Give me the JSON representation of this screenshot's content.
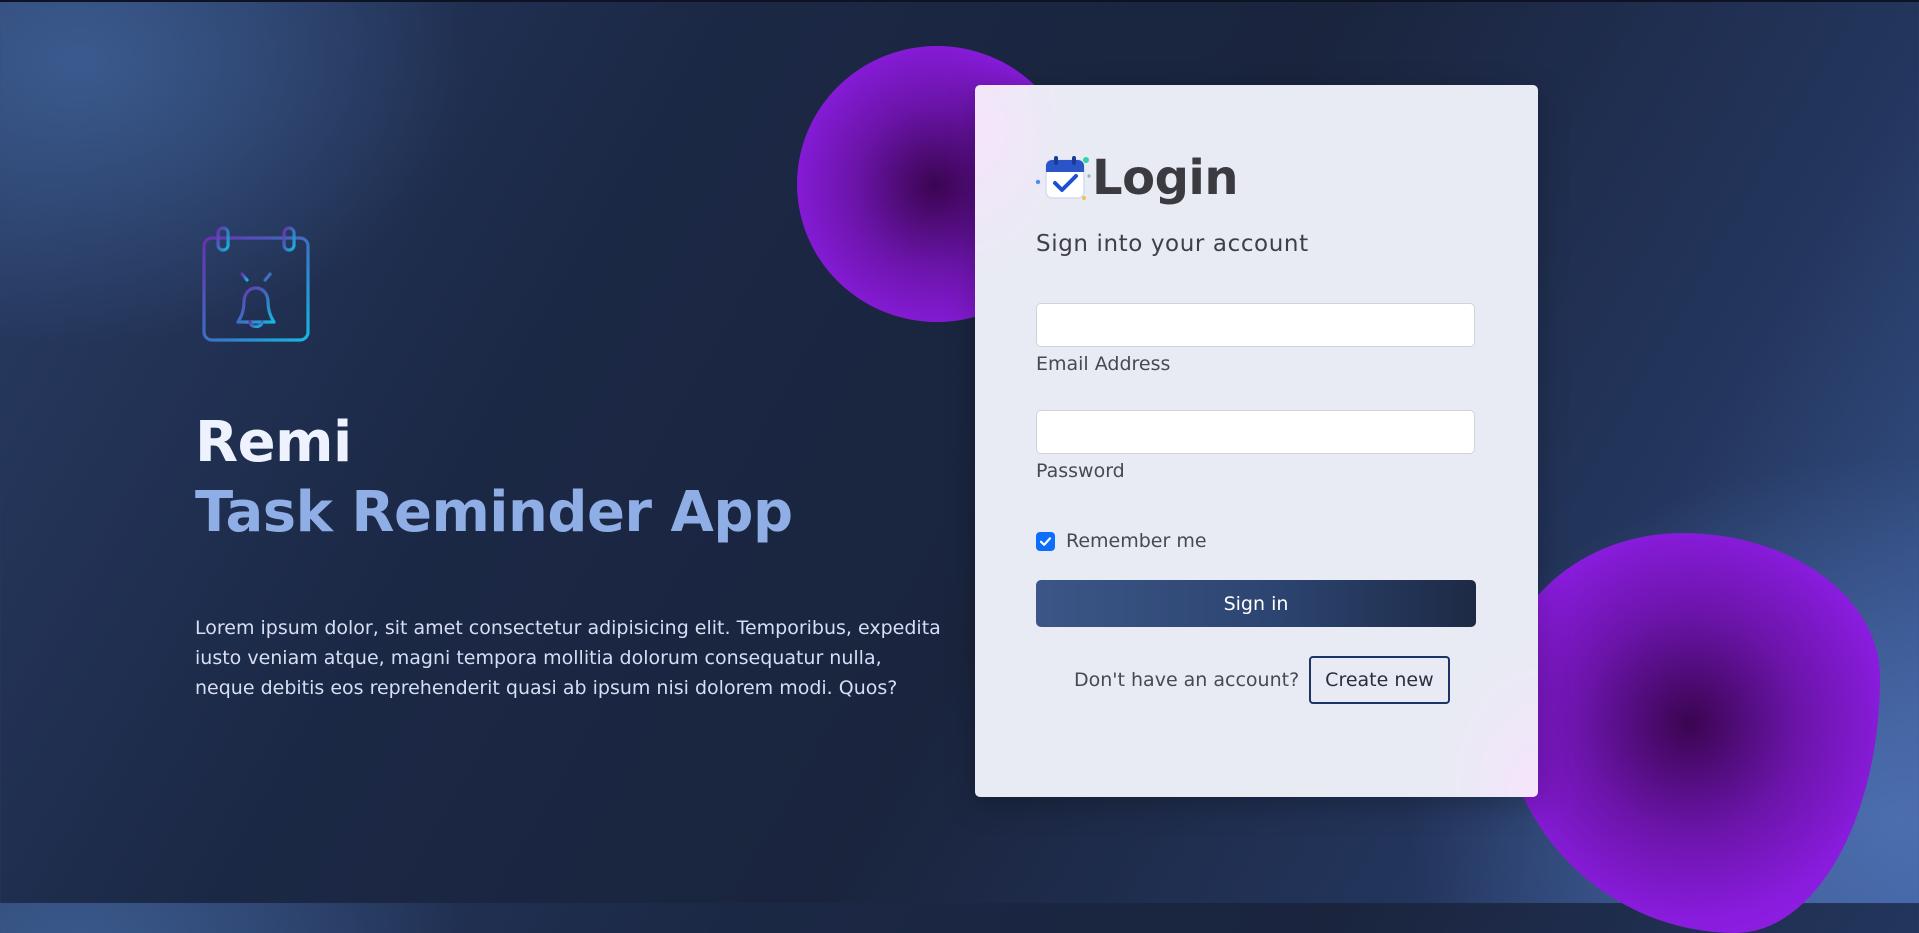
{
  "hero": {
    "icon": "calendar-bell-icon",
    "title_line1": "Remi",
    "title_line2": "Task Reminder App",
    "description": "Lorem ipsum dolor, sit amet consectetur adipisicing elit. Temporibus, expedita iusto veniam atque, magni tempora mollitia dolorum consequatur nulla, neque debitis eos reprehenderit quasi ab ipsum nisi dolorem modi. Quos?"
  },
  "login": {
    "logo_icon": "calendar-check-icon",
    "title": "Login",
    "subtitle": "Sign into your account",
    "email": {
      "value": "",
      "label": "Email Address"
    },
    "password": {
      "value": "",
      "label": "Password"
    },
    "remember_label": "Remember me",
    "remember_checked": true,
    "signin_label": "Sign in",
    "no_account_text": "Don't have an account?",
    "create_label": "Create new"
  },
  "colors": {
    "accent_blue": "#0d6efd",
    "title_light": "#eef2ff",
    "title_blue": "#8faee6",
    "blob_purple": "#8a1cde",
    "button_dark": "#2c4470"
  }
}
